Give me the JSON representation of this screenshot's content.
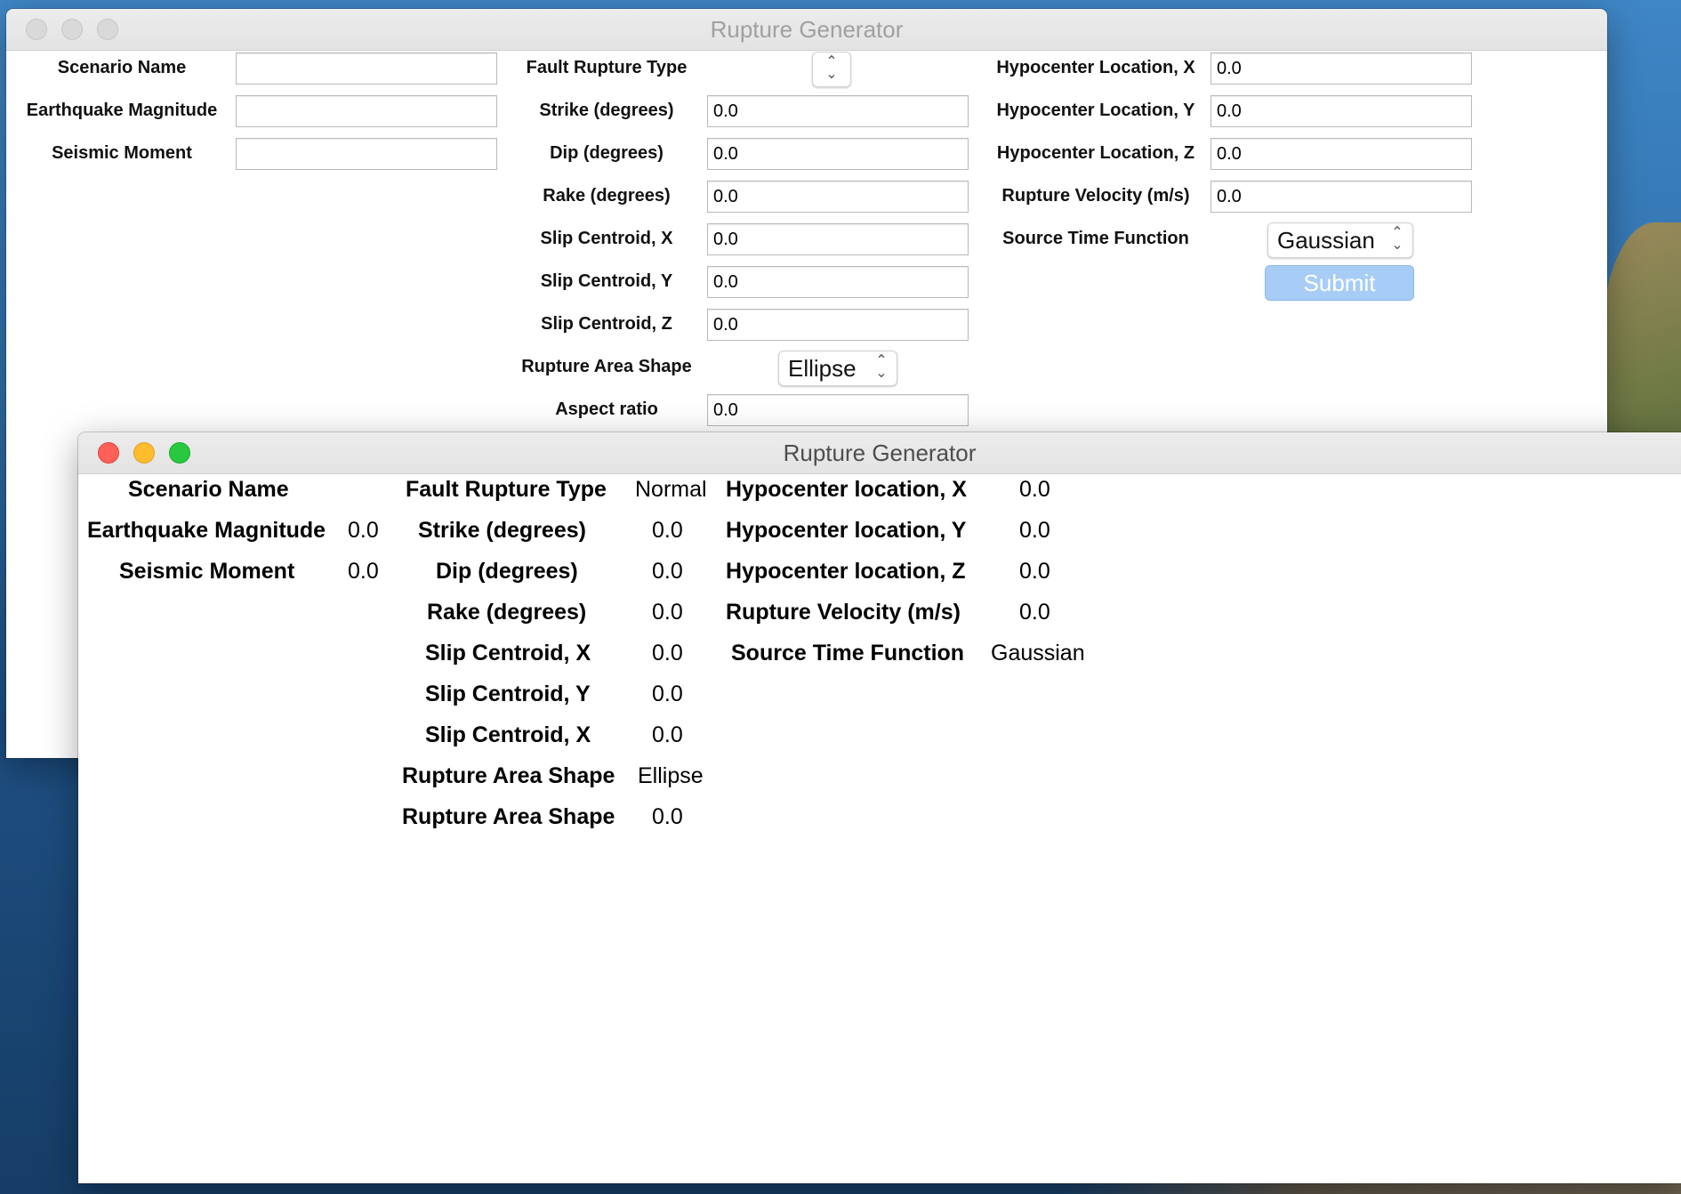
{
  "input_window": {
    "title": "Rupture Generator",
    "col1": [
      {
        "label": "Scenario Name",
        "value": ""
      },
      {
        "label": "Earthquake Magnitude",
        "value": ""
      },
      {
        "label": "Seismic Moment",
        "value": ""
      }
    ],
    "col2": {
      "fault_type_label": "Fault Rupture Type",
      "fault_type_value": "",
      "fields": [
        {
          "label": "Strike (degrees)",
          "value": "0.0"
        },
        {
          "label": "Dip (degrees)",
          "value": "0.0"
        },
        {
          "label": "Rake (degrees)",
          "value": "0.0"
        },
        {
          "label": "Slip Centroid, X",
          "value": "0.0"
        },
        {
          "label": "Slip Centroid, Y",
          "value": "0.0"
        },
        {
          "label": "Slip Centroid, Z",
          "value": "0.0"
        }
      ],
      "shape_label": "Rupture Area Shape",
      "shape_value": "Ellipse",
      "aspect_label": "Aspect ratio",
      "aspect_value": "0.0"
    },
    "col3": {
      "fields": [
        {
          "label": "Hypocenter Location, X",
          "value": "0.0"
        },
        {
          "label": "Hypocenter Location, Y",
          "value": "0.0"
        },
        {
          "label": "Hypocenter Location, Z",
          "value": "0.0"
        },
        {
          "label": "Rupture Velocity (m/s)",
          "value": "0.0"
        }
      ],
      "stf_label": "Source Time Function",
      "stf_value": "Gaussian",
      "submit_label": "Submit"
    }
  },
  "output_window": {
    "title": "Rupture Generator",
    "col1": [
      {
        "label": "Scenario Name",
        "value": ""
      },
      {
        "label": "Earthquake Magnitude",
        "value": "0.0"
      },
      {
        "label": "Seismic Moment",
        "value": "0.0"
      }
    ],
    "col2": [
      {
        "label": "Fault Rupture Type",
        "value": "Normal"
      },
      {
        "label": "Strike (degrees)",
        "value": "0.0"
      },
      {
        "label": "Dip (degrees)",
        "value": "0.0"
      },
      {
        "label": "Rake (degrees)",
        "value": "0.0"
      },
      {
        "label": "Slip Centroid, X",
        "value": "0.0"
      },
      {
        "label": "Slip Centroid, Y",
        "value": "0.0"
      },
      {
        "label": "Slip Centroid, X",
        "value": "0.0"
      },
      {
        "label": "Rupture Area Shape",
        "value": "Ellipse"
      },
      {
        "label": "Rupture Area Shape",
        "value": "0.0"
      }
    ],
    "col3": [
      {
        "label": "Hypocenter location, X",
        "value": "0.0"
      },
      {
        "label": "Hypocenter location, Y",
        "value": "0.0"
      },
      {
        "label": "Hypocenter location, Z",
        "value": "0.0"
      },
      {
        "label": "Rupture Velocity (m/s)",
        "value": "0.0"
      },
      {
        "label": "Source Time Function",
        "value": "Gaussian"
      }
    ]
  }
}
